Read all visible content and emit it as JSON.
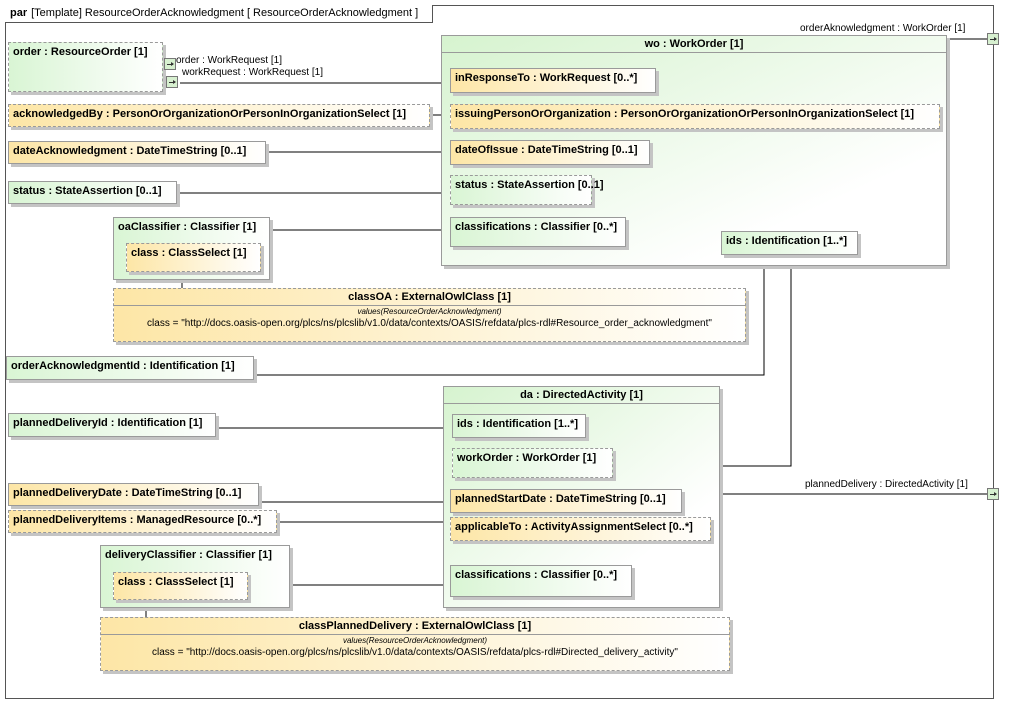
{
  "frame": {
    "kind": "par",
    "title": "[Template] ResourceOrderAcknowledgment [ ResourceOrderAcknowledgment ]"
  },
  "parts": {
    "order": "order : ResourceOrder [1]",
    "acknowledgedBy": "acknowledgedBy : PersonOrOrganizationOrPersonInOrganizationSelect [1]",
    "dateAcknowledgment": "dateAcknowledgment : DateTimeString [0..1]",
    "status": "status : StateAssertion [0..1]",
    "oaClassifier": "oaClassifier : Classifier [1]",
    "oaClass": "class : ClassSelect [1]",
    "classOA": "classOA : ExternalOwlClass [1]",
    "classOA_values": "values(ResourceOrderAcknowledgment)",
    "classOA_value": "class = \"http://docs.oasis-open.org/plcs/ns/plcslib/v1.0/data/contexts/OASIS/refdata/plcs-rdl#Resource_order_acknowledgment\"",
    "orderAcknowledgmentId": "orderAcknowledgmentId : Identification [1]",
    "plannedDeliveryId": "plannedDeliveryId : Identification [1]",
    "plannedDeliveryDate": "plannedDeliveryDate : DateTimeString [0..1]",
    "plannedDeliveryItems": "plannedDeliveryItems : ManagedResource [0..*]",
    "deliveryClassifier": "deliveryClassifier : Classifier [1]",
    "deliveryClass": "class : ClassSelect [1]",
    "classPlannedDelivery": "classPlannedDelivery : ExternalOwlClass [1]",
    "classPD_values": "values(ResourceOrderAcknowledgment)",
    "classPD_value": "class = \"http://docs.oasis-open.org/plcs/ns/plcslib/v1.0/data/contexts/OASIS/refdata/plcs-rdl#Directed_delivery_activity\"",
    "wo": "wo : WorkOrder [1]",
    "wo_inResponseTo": "inResponseTo : WorkRequest [0..*]",
    "wo_issuing": "issuingPersonOrOrganization : PersonOrOrganizationOrPersonInOrganizationSelect [1]",
    "wo_dateOfIssue": "dateOfIssue : DateTimeString [0..1]",
    "wo_status": "status : StateAssertion [0..1]",
    "wo_classifications": "classifications : Classifier [0..*]",
    "wo_ids": "ids : Identification [1..*]",
    "da": "da : DirectedActivity [1]",
    "da_ids": "ids : Identification [1..*]",
    "da_workOrder": "workOrder : WorkOrder [1]",
    "da_plannedStartDate": "plannedStartDate : DateTimeString [0..1]",
    "da_applicableTo": "applicableTo : ActivityAssignmentSelect [0..*]",
    "da_classifications": "classifications : Classifier [0..*]"
  },
  "ports": {
    "order_workRequest": "order : WorkRequest [1]",
    "workRequest": "workRequest : WorkRequest [1]",
    "orderAknowledgment": "orderAknowledgment : WorkOrder [1]",
    "plannedDelivery": "plannedDelivery : DirectedActivity [1]"
  }
}
